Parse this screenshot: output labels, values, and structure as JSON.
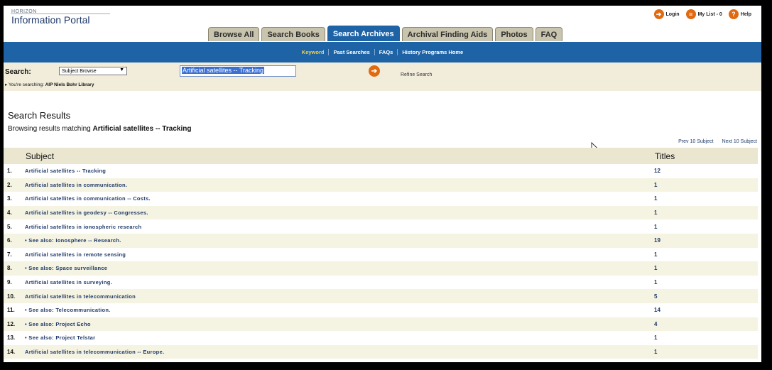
{
  "header": {
    "logo_small": "HORIZON",
    "logo_main": "Information Portal",
    "links": [
      {
        "label": "Login",
        "icon": "login-icon"
      },
      {
        "label": "My List - 0",
        "icon": "list-icon"
      },
      {
        "label": "Help",
        "icon": "help-icon"
      }
    ]
  },
  "tabs": [
    "Browse All",
    "Search Books",
    "Search Archives",
    "Archival Finding Aids",
    "Photos",
    "FAQ"
  ],
  "active_tab": "Search Archives",
  "subnav": [
    "Keyword",
    "Past Searches",
    "FAQs",
    "History Programs Home"
  ],
  "search": {
    "label": "Search:",
    "type_value": "Subject Browse",
    "query": "Artificial satellites -- Tracking",
    "refine": "Refine Search",
    "searching_prefix": "You're searching:",
    "searching_library": "AIP Niels Bohr Library"
  },
  "results": {
    "title": "Search Results",
    "browse_prefix": "Browsing results matching",
    "browse_term": "Artificial satellites -- Tracking",
    "prev": "Prev 10 Subject",
    "next": "Next 10 Subject",
    "col_subject": "Subject",
    "col_titles": "Titles",
    "rows": [
      {
        "num": "1.",
        "subject": "Artificial satellites -- Tracking",
        "titles": "12"
      },
      {
        "num": "2.",
        "subject": "Artificial satellites in communication.",
        "titles": "1"
      },
      {
        "num": "3.",
        "subject": "Artificial satellites in communication -- Costs.",
        "titles": "1"
      },
      {
        "num": "4.",
        "subject": "Artificial satellites in geodesy -- Congresses.",
        "titles": "1"
      },
      {
        "num": "5.",
        "subject": "Artificial satellites in ionospheric research",
        "titles": "1"
      },
      {
        "num": "6.",
        "subject": "• See also: Ionosphere -- Research.",
        "titles": "19"
      },
      {
        "num": "7.",
        "subject": "Artificial satellites in remote sensing",
        "titles": "1"
      },
      {
        "num": "8.",
        "subject": "• See also: Space surveillance",
        "titles": "1"
      },
      {
        "num": "9.",
        "subject": "Artificial satellites in surveying.",
        "titles": "1"
      },
      {
        "num": "10.",
        "subject": "Artificial satellites in telecommunication",
        "titles": "5"
      },
      {
        "num": "11.",
        "subject": "• See also: Telecommunication.",
        "titles": "14"
      },
      {
        "num": "12.",
        "subject": "• See also: Project Echo",
        "titles": "4"
      },
      {
        "num": "13.",
        "subject": "• See also: Project Telstar",
        "titles": "1"
      },
      {
        "num": "14.",
        "subject": "Artificial satellites in telecommunication -- Europe.",
        "titles": "1"
      }
    ]
  },
  "colors": {
    "nav_blue": "#1d63a6",
    "tab_tan": "#c9c4ad",
    "search_bg": "#f1edda",
    "icon_orange": "#e06a10",
    "link_navy": "#1f3a6a",
    "active_subnav": "#f2d24a"
  }
}
